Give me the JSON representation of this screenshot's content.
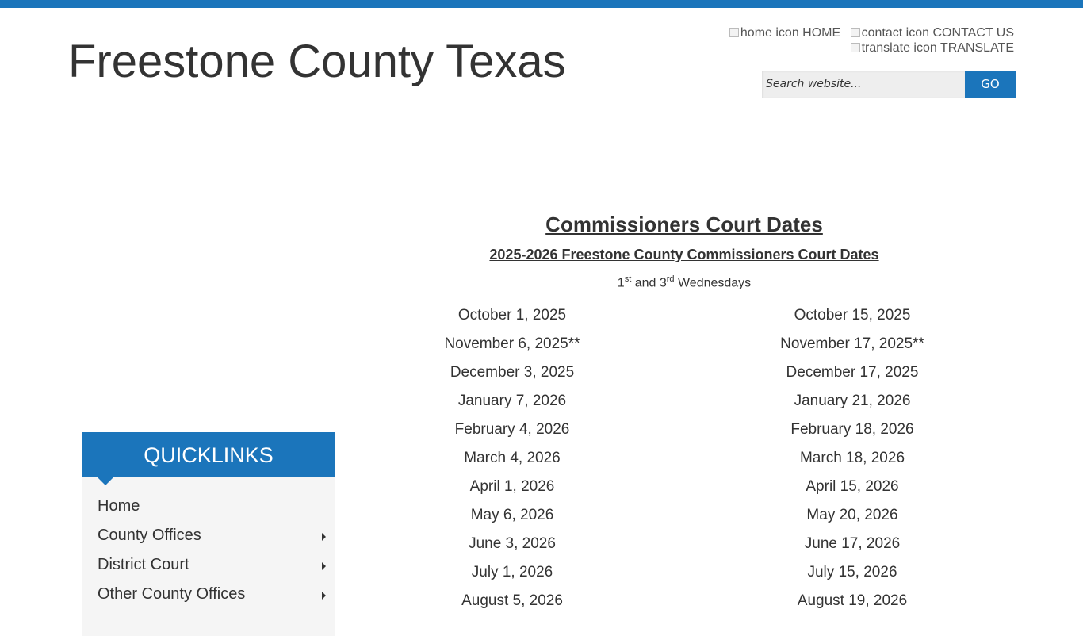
{
  "site": {
    "title": "Freestone County Texas",
    "accent_color": "#1b75bb"
  },
  "utility_nav": {
    "home": {
      "icon": "home-icon",
      "alt": "home icon",
      "label": "HOME"
    },
    "contact": {
      "icon": "contact-icon",
      "alt": "contact icon",
      "label": "CONTACT US"
    },
    "translate": {
      "icon": "translate-icon",
      "alt": "translate icon",
      "label": "TRANSLATE"
    }
  },
  "search": {
    "placeholder": "Search website...",
    "value": "",
    "button_label": "GO"
  },
  "quicklinks": {
    "title": "QUICKLINKS",
    "items": [
      {
        "label": "Home",
        "has_submenu": false
      },
      {
        "label": "County Offices",
        "has_submenu": true
      },
      {
        "label": "District Court",
        "has_submenu": true
      },
      {
        "label": "Other County Offices",
        "has_submenu": true
      }
    ]
  },
  "content": {
    "heading": "Commissioners Court Dates",
    "subheading": "2025-2026 Freestone County Commissioners Court Dates",
    "meeting_days": {
      "first": "1",
      "first_suffix": "st",
      "and": " and 3",
      "third_suffix": "rd",
      "rest": " Wednesdays"
    },
    "dates": [
      {
        "left": "October 1, 2025",
        "right": "October 15, 2025"
      },
      {
        "left": "November 6, 2025**",
        "right": "November 17, 2025**"
      },
      {
        "left": "December 3, 2025",
        "right": "December 17, 2025"
      },
      {
        "left": "January 7, 2026",
        "right": "January 21, 2026"
      },
      {
        "left": "February 4, 2026",
        "right": "February 18, 2026"
      },
      {
        "left": "March 4, 2026",
        "right": "March 18, 2026"
      },
      {
        "left": "April 1, 2026",
        "right": "April 15, 2026"
      },
      {
        "left": "May 6, 2026",
        "right": "May 20, 2026"
      },
      {
        "left": "June 3, 2026",
        "right": "June 17, 2026"
      },
      {
        "left": "July 1, 2026",
        "right": "July 15, 2026"
      },
      {
        "left": "August 5, 2026",
        "right": "August 19, 2026"
      }
    ]
  }
}
